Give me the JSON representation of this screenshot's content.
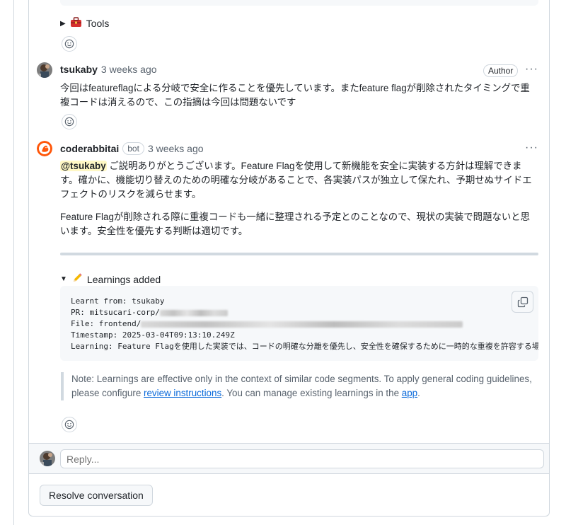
{
  "tools_details": {
    "icon": "toolbox-icon",
    "label": "Tools"
  },
  "comments": [
    {
      "author": "tsukaby",
      "time": "3 weeks ago",
      "author_badge": "Author",
      "body": "今回はfeatureflagによる分岐で安全に作ることを優先しています。またfeature flagが削除されたタイミングで重複コードは消えるので、この指摘は今回は問題ないです"
    },
    {
      "author": "coderabbitai",
      "bot_badge": "bot",
      "time": "3 weeks ago",
      "mention": "@tsukaby",
      "para1": "ご説明ありがとうございます。Feature Flagを使用して新機能を安全に実装する方針は理解できます。確かに、機能切り替えのための明確な分岐があることで、各実装パスが独立して保たれ、予期せぬサイドエフェクトのリスクを減らせます。",
      "para2": "Feature Flagが削除される際に重複コードも一緒に整理される予定とのことなので、現状の実装で問題ないと思います。安全性を優先する判断は適切です。",
      "learnings": {
        "summary": "Learnings added",
        "icon": "pencil-icon",
        "lines": {
          "l1": "Learnt from: tsukaby",
          "l2": "PR: mitsucari-corp/",
          "l3": "File: frontend/",
          "l4": "Timestamp: 2025-03-04T09:13:10.249Z",
          "l5": "Learning: Feature Flagを使用した実装では、コードの明確な分離を優先し、安全性を確保するために一時的な重複を許容する場合"
        }
      },
      "note": {
        "prefix": "Note: Learnings are effective only in the context of similar code segments. To apply general coding guidelines, please configure ",
        "link1": "review instructions",
        "middle": ". You can manage existing learnings in the ",
        "link2": "app",
        "suffix": "."
      }
    }
  ],
  "reply": {
    "placeholder": "Reply..."
  },
  "resolve_label": "Resolve conversation",
  "colors": {
    "accent_link": "#0969da",
    "mention_bg": "#fff8c5",
    "border": "#d0d7de"
  }
}
